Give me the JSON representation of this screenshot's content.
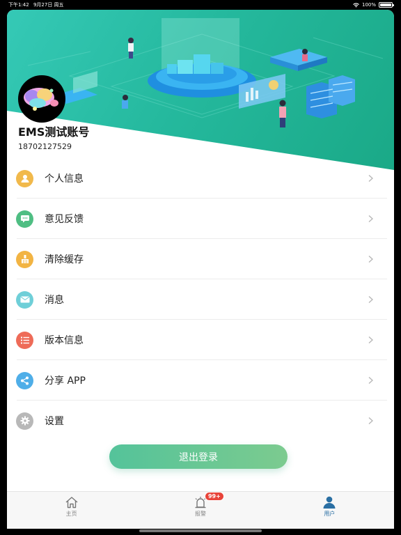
{
  "status_bar": {
    "time": "下午1:42",
    "date": "9月27日 周五",
    "battery": "100%"
  },
  "profile": {
    "username": "EMS测试账号",
    "phone": "18702127529"
  },
  "menu": {
    "items": [
      {
        "label": "个人信息",
        "icon": "person-icon",
        "color": "#f1b94b"
      },
      {
        "label": "意见反馈",
        "icon": "feedback-icon",
        "color": "#4fbe83"
      },
      {
        "label": "清除缓存",
        "icon": "broom-icon",
        "color": "#f2b443"
      },
      {
        "label": "消息",
        "icon": "mail-icon",
        "color": "#6fcfd8"
      },
      {
        "label": "版本信息",
        "icon": "list-icon",
        "color": "#ee6b58"
      },
      {
        "label": "分享 APP",
        "icon": "share-icon",
        "color": "#4faee8"
      },
      {
        "label": "设置",
        "icon": "gear-icon",
        "color": "#b8b8b8"
      }
    ]
  },
  "logout_label": "退出登录",
  "tabs": [
    {
      "label": "主页",
      "icon": "home-icon",
      "active": false
    },
    {
      "label": "报警",
      "icon": "alarm-icon",
      "active": false,
      "badge": "99+"
    },
    {
      "label": "用户",
      "icon": "user-icon",
      "active": true
    }
  ],
  "colors": {
    "header_green": "#25b99e",
    "accent_blue": "#2a6fa3",
    "logout_green": "#54c39a",
    "badge_red": "#e8443a"
  }
}
